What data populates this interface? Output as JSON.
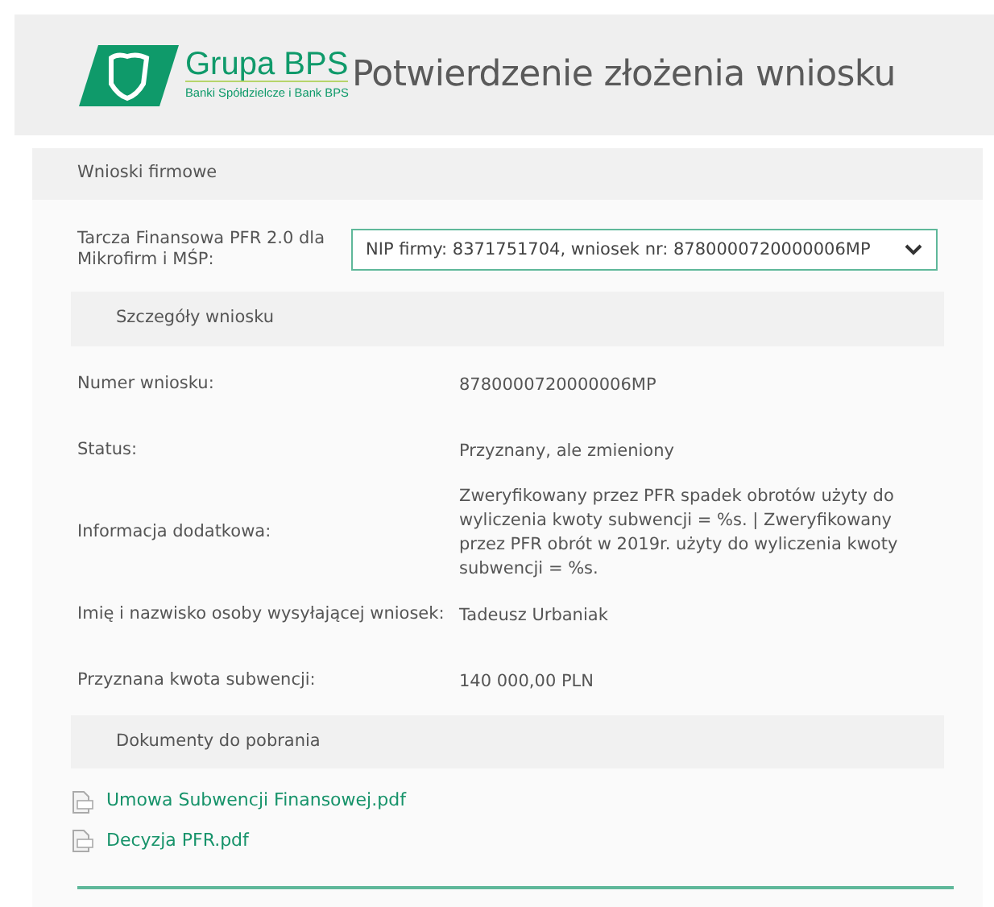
{
  "header": {
    "logo": {
      "name": "Grupa BPS",
      "tagline": "Banki Spółdzielcze i Bank BPS"
    },
    "title": "Potwierdzenie złożenia wniosku"
  },
  "section": {
    "title": "Wnioski firmowe"
  },
  "selector": {
    "label": "Tarcza Finansowa PFR 2.0 dla Mikrofirm i MŚP:",
    "value": "NIP firmy: 8371751704, wniosek nr: 8780000720000006MP"
  },
  "details": {
    "title": "Szczegóły wniosku",
    "rows": [
      {
        "label": "Numer wniosku:",
        "value": "8780000720000006MP"
      },
      {
        "label": "Status:",
        "value": "Przyznany, ale zmieniony"
      },
      {
        "label": "Informacja dodatkowa:",
        "value": "Zweryfikowany przez PFR spadek obrotów użyty do wyliczenia kwoty subwencji = %s. | Zweryfikowany przez PFR obrót w 2019r. użyty do wyliczenia kwoty subwencji = %s."
      },
      {
        "label": "Imię i nazwisko osoby wysyłającej wniosek:",
        "value": "Tadeusz Urbaniak"
      },
      {
        "label": "Przyznana kwota subwencji:",
        "value": "140 000,00 PLN"
      }
    ]
  },
  "documents": {
    "title": "Dokumenty do pobrania",
    "files": [
      {
        "name": "Umowa Subwencji Finansowej.pdf"
      },
      {
        "name": "Decyzja PFR.pdf"
      }
    ]
  }
}
